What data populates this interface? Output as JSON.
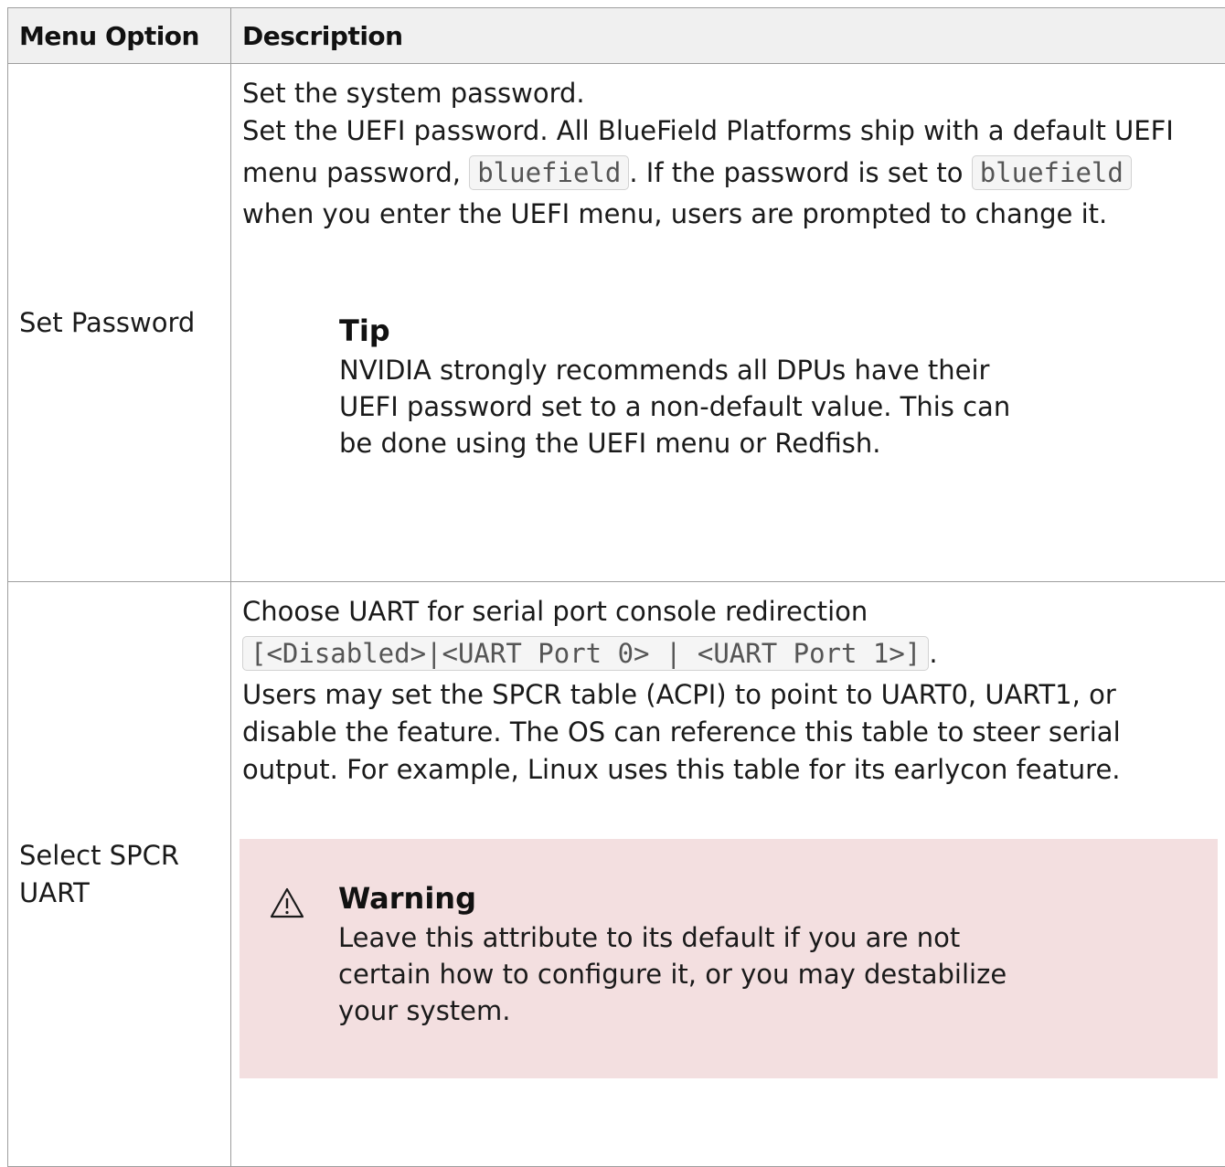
{
  "table": {
    "headers": [
      "Menu Option",
      "Description"
    ],
    "rows": [
      {
        "option": "Set Password",
        "desc_line1": "Set the system password.",
        "desc_line2": "Set the UEFI password. All BlueField Platforms ship with a default UEFI",
        "desc_line3_a": "menu password, ",
        "desc_line3_code1": "bluefield",
        "desc_line3_b": ". If the password is set to ",
        "desc_line3_code2": "bluefield",
        "desc_line4": "when you enter the UEFI menu, users are prompted to change it.",
        "callout": {
          "title": "Tip",
          "lines": [
            "NVIDIA strongly recommends all DPUs have their",
            "UEFI password set to a non-default value. This can",
            "be done using the UEFI menu or Redfish."
          ]
        }
      },
      {
        "option_line1": "Select SPCR",
        "option_line2": "UART",
        "desc_line1": "Choose UART for serial port console redirection",
        "desc_code": "[<Disabled>|<UART Port 0> | <UART Port 1>]",
        "desc_code_after": ".",
        "desc_line3": "Users may set the SPCR table (ACPI) to point to UART0, UART1, or",
        "desc_line4": "disable the feature. The OS can reference this table to steer serial",
        "desc_line5": "output. For example, Linux uses this table for its earlycon feature.",
        "callout": {
          "icon": "warning-triangle-icon",
          "title": "Warning",
          "background": "#f3dfe0",
          "lines": [
            "Leave this attribute to its default if you are not",
            "certain how to configure it, or you may destabilize",
            "your system."
          ]
        }
      }
    ]
  }
}
